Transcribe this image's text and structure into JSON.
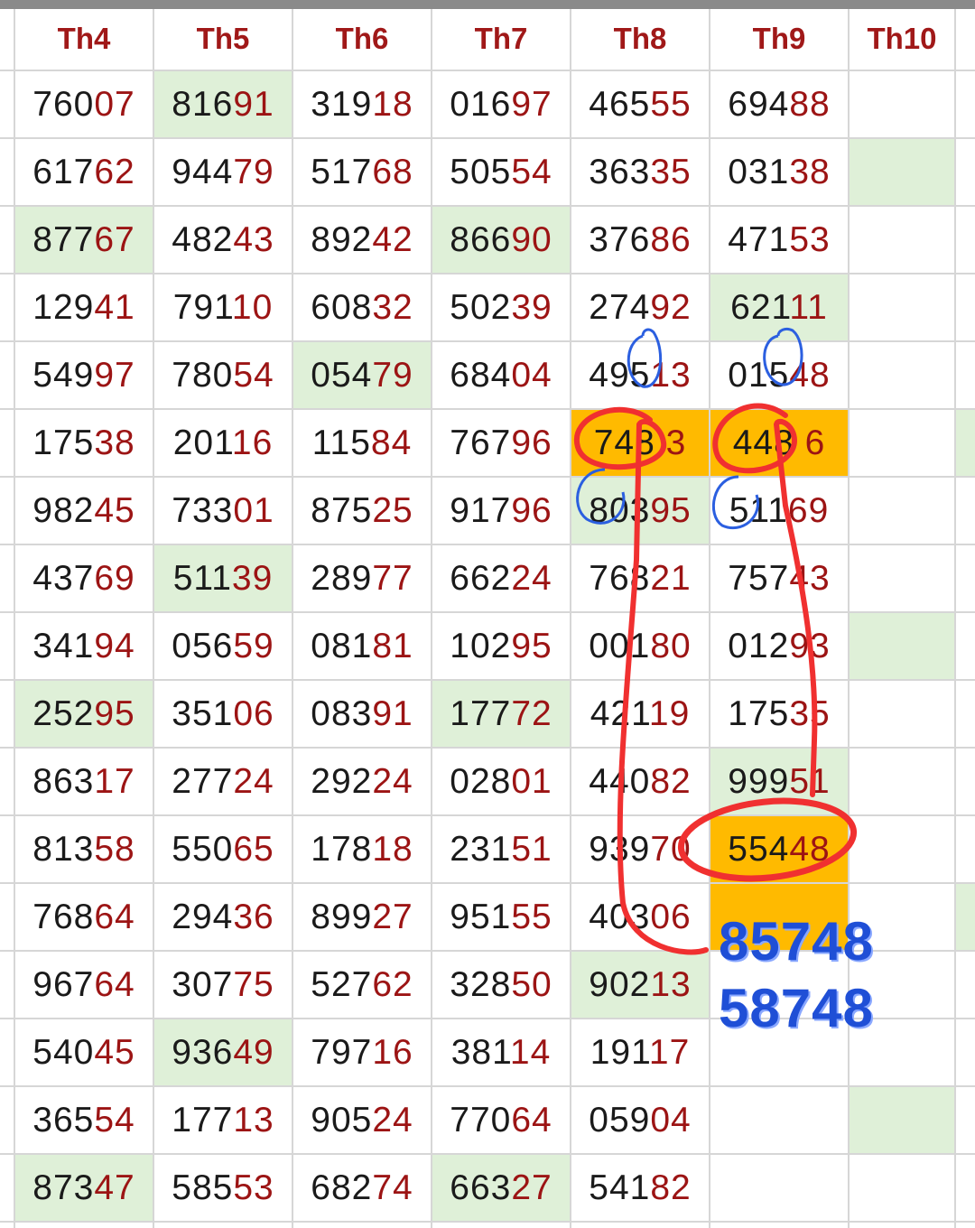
{
  "headers": [
    "Th4",
    "Th5",
    "Th6",
    "Th7",
    "Th8",
    "Th9",
    "Th10"
  ],
  "rows": [
    [
      "76007",
      "81691",
      "31918",
      "01697",
      "46555",
      "69488",
      ""
    ],
    [
      "61762",
      "94479",
      "51768",
      "50554",
      "36335",
      "03138",
      ""
    ],
    [
      "87767",
      "48243",
      "89242",
      "86690",
      "37686",
      "47153",
      ""
    ],
    [
      "12941",
      "79110",
      "60832",
      "50239",
      "27492",
      "62111",
      ""
    ],
    [
      "54997",
      "78054",
      "05479",
      "68404",
      "49513",
      "01548",
      ""
    ],
    [
      "17538",
      "20116",
      "11584",
      "76796",
      "748 3",
      "448 6",
      ""
    ],
    [
      "98245",
      "73301",
      "87525",
      "91796",
      "80395",
      "51169",
      ""
    ],
    [
      "43769",
      "51139",
      "28977",
      "66224",
      "76821",
      "75743",
      ""
    ],
    [
      "34194",
      "05659",
      "08181",
      "10295",
      "00180",
      "01293",
      ""
    ],
    [
      "25295",
      "35106",
      "08391",
      "17772",
      "42119",
      "17535",
      ""
    ],
    [
      "86317",
      "27724",
      "29224",
      "02801",
      "44082",
      "99951",
      ""
    ],
    [
      "81358",
      "55065",
      "17818",
      "23151",
      "93970",
      "55448",
      ""
    ],
    [
      "76864",
      "29436",
      "89927",
      "95155",
      "40306",
      "",
      ""
    ],
    [
      "96764",
      "30775",
      "52762",
      "32850",
      "90213",
      "",
      ""
    ],
    [
      "54045",
      "93649",
      "79716",
      "38114",
      "19117",
      "",
      ""
    ],
    [
      "36554",
      "17713",
      "90524",
      "77064",
      "05904",
      "",
      ""
    ],
    [
      "87347",
      "58553",
      "68274",
      "66327",
      "54182",
      "",
      ""
    ]
  ],
  "highlights": {
    "green": [
      [
        0,
        1
      ],
      [
        1,
        6
      ],
      [
        2,
        0
      ],
      [
        2,
        3
      ],
      [
        3,
        5
      ],
      [
        4,
        2
      ],
      [
        6,
        4
      ],
      [
        7,
        1
      ],
      [
        8,
        6
      ],
      [
        9,
        0
      ],
      [
        9,
        3
      ],
      [
        10,
        5
      ],
      [
        12,
        7
      ],
      [
        13,
        4
      ],
      [
        14,
        1
      ],
      [
        15,
        6
      ],
      [
        16,
        0
      ],
      [
        16,
        3
      ],
      [
        5,
        7
      ]
    ],
    "orange": [
      [
        5,
        4
      ],
      [
        5,
        5
      ],
      [
        11,
        5
      ],
      [
        12,
        5
      ]
    ]
  },
  "annotations": {
    "note_line1": "85748",
    "note_line2": "58748"
  },
  "colors": {
    "header_text": "#a01818",
    "digit_tail": "#9c1414",
    "green_fill": "#dff0d8",
    "orange_fill": "#ffba00",
    "red_ink": "#f03030",
    "blue_ink": "#1f4fd6"
  }
}
